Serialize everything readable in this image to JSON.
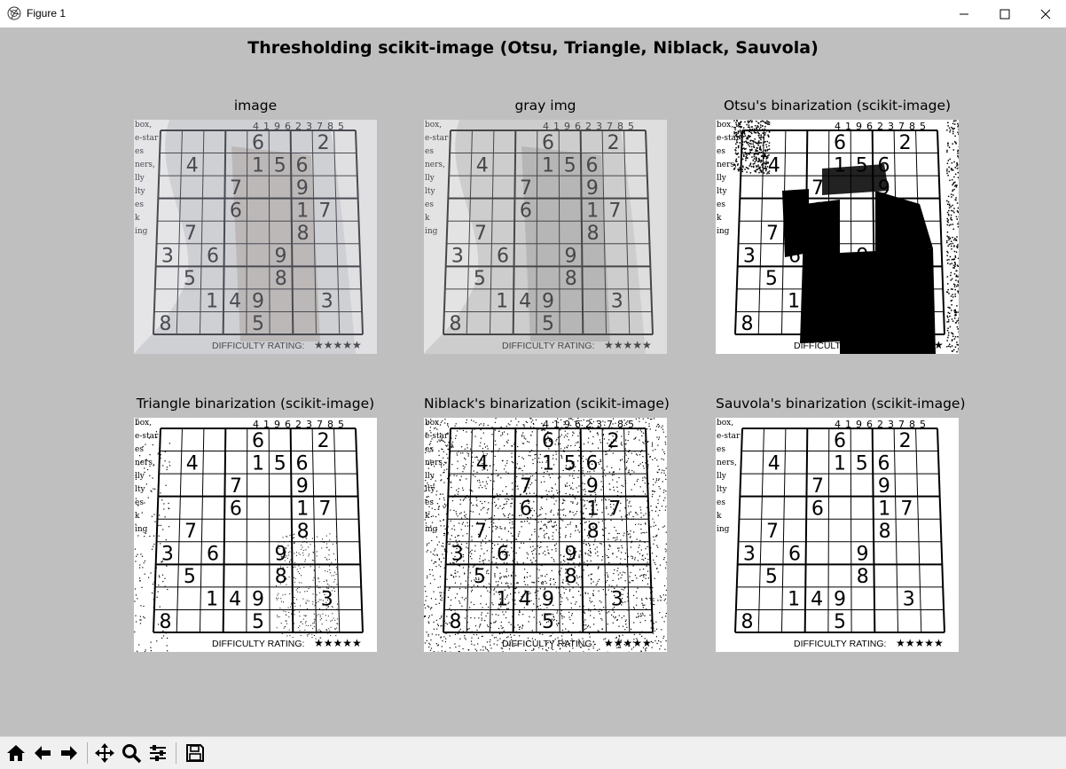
{
  "window": {
    "title": "Figure 1"
  },
  "figure": {
    "suptitle": "Thresholding scikit-image (Otsu, Triangle, Niblack, Sauvola)",
    "background": "#bfbfbf"
  },
  "panels": [
    {
      "title": "image",
      "style": "photo"
    },
    {
      "title": "gray img",
      "style": "gray"
    },
    {
      "title": "Otsu's binarization (scikit-image)",
      "style": "otsu"
    },
    {
      "title": "Triangle binarization (scikit-image)",
      "style": "triangle"
    },
    {
      "title": "Niblack's binarization (scikit-image)",
      "style": "niblack"
    },
    {
      "title": "Sauvola's binarization (scikit-image)",
      "style": "sauvola"
    }
  ],
  "sudoku": {
    "header_digits": [
      "4",
      "1",
      "9",
      "6",
      "2",
      "3",
      "7",
      "8",
      "5"
    ],
    "clues": [
      {
        "r": 0,
        "c": 4,
        "v": "6"
      },
      {
        "r": 0,
        "c": 7,
        "v": "2"
      },
      {
        "r": 1,
        "c": 1,
        "v": "4"
      },
      {
        "r": 1,
        "c": 4,
        "v": "1"
      },
      {
        "r": 1,
        "c": 5,
        "v": "5"
      },
      {
        "r": 1,
        "c": 6,
        "v": "6"
      },
      {
        "r": 2,
        "c": 3,
        "v": "7"
      },
      {
        "r": 2,
        "c": 6,
        "v": "9"
      },
      {
        "r": 3,
        "c": 3,
        "v": "6"
      },
      {
        "r": 3,
        "c": 6,
        "v": "1"
      },
      {
        "r": 3,
        "c": 7,
        "v": "7"
      },
      {
        "r": 4,
        "c": 1,
        "v": "7"
      },
      {
        "r": 4,
        "c": 6,
        "v": "8"
      },
      {
        "r": 5,
        "c": 0,
        "v": "3"
      },
      {
        "r": 5,
        "c": 2,
        "v": "6"
      },
      {
        "r": 5,
        "c": 5,
        "v": "9"
      },
      {
        "r": 6,
        "c": 1,
        "v": "5"
      },
      {
        "r": 6,
        "c": 5,
        "v": "8"
      },
      {
        "r": 7,
        "c": 2,
        "v": "1"
      },
      {
        "r": 7,
        "c": 3,
        "v": "4"
      },
      {
        "r": 7,
        "c": 4,
        "v": "9"
      },
      {
        "r": 7,
        "c": 7,
        "v": "3"
      },
      {
        "r": 8,
        "c": 0,
        "v": "8"
      },
      {
        "r": 8,
        "c": 4,
        "v": "5"
      }
    ],
    "side_text": [
      "box,",
      "e-star",
      "es",
      "ners,",
      "lly",
      "lty",
      "es",
      "k",
      "ing"
    ],
    "footer": "DIFFICULTY RATING:",
    "stars": "★★★★★"
  },
  "toolbar": {
    "buttons": [
      {
        "name": "home-icon"
      },
      {
        "name": "back-icon"
      },
      {
        "name": "forward-icon"
      },
      {
        "name": "pan-icon"
      },
      {
        "name": "zoom-icon"
      },
      {
        "name": "configure-subplots-icon"
      },
      {
        "name": "save-icon"
      }
    ]
  }
}
